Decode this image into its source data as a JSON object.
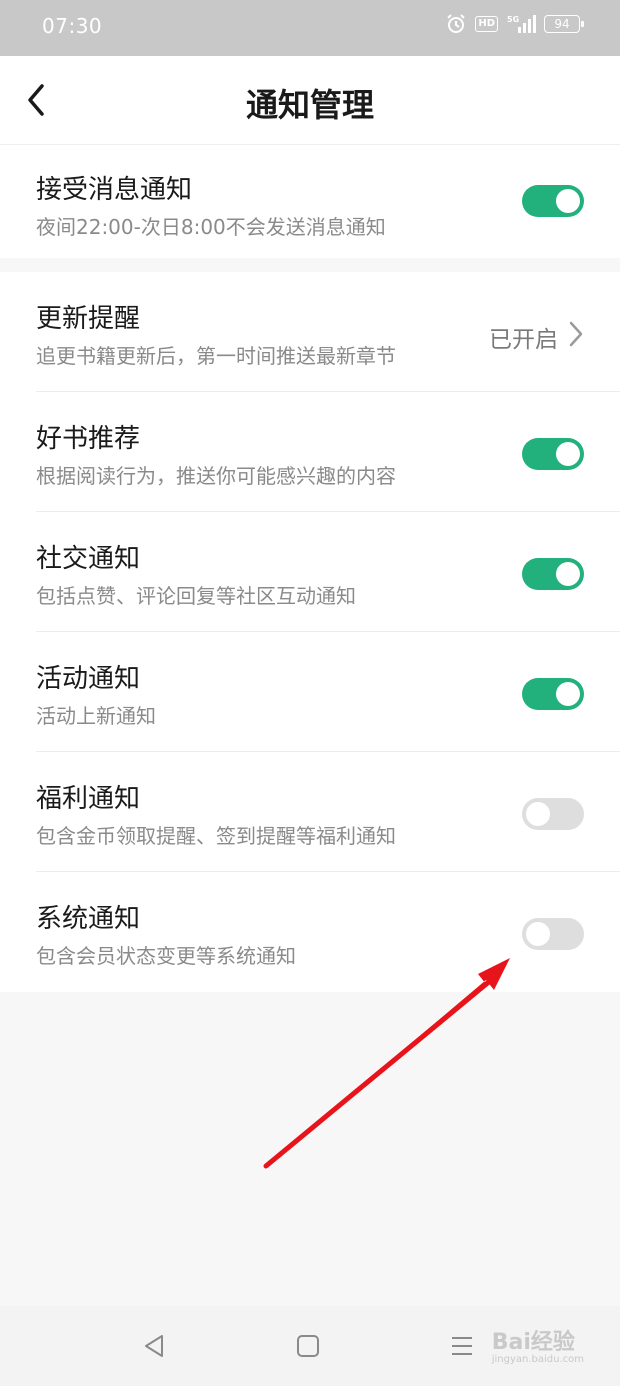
{
  "status_bar": {
    "time": "07:30",
    "hd": "HD",
    "battery": "94",
    "icons": [
      "alarm-icon",
      "hd-icon",
      "5g-signal-icon",
      "battery-icon"
    ]
  },
  "header": {
    "title": "通知管理",
    "back_icon": "chevron-left-icon"
  },
  "receive": {
    "title": "接受消息通知",
    "subtitle": "夜间22:00-次日8:00不会发送消息通知",
    "enabled": true
  },
  "settings": [
    {
      "title": "更新提醒",
      "subtitle": "追更书籍更新后，第一时间推送最新章节",
      "status": "已开启"
    },
    {
      "title": "好书推荐",
      "subtitle": "根据阅读行为，推送你可能感兴趣的内容",
      "enabled": true
    },
    {
      "title": "社交通知",
      "subtitle": "包括点赞、评论回复等社区互动通知",
      "enabled": true
    },
    {
      "title": "活动通知",
      "subtitle": "活动上新通知",
      "enabled": true
    },
    {
      "title": "福利通知",
      "subtitle": "包含金币领取提醒、签到提醒等福利通知",
      "enabled": false
    },
    {
      "title": "系统通知",
      "subtitle": "包含会员状态变更等系统通知",
      "enabled": false
    }
  ],
  "nav_bar": {
    "icons": [
      "back-triangle-icon",
      "home-square-icon",
      "menu-lines-icon"
    ],
    "watermark": "Bai经验",
    "watermark_sub": "jingyan.baidu.com"
  },
  "colors": {
    "toggle_on": "#22b07d",
    "toggle_off": "#dedede",
    "annotation_arrow": "#e8141b"
  }
}
